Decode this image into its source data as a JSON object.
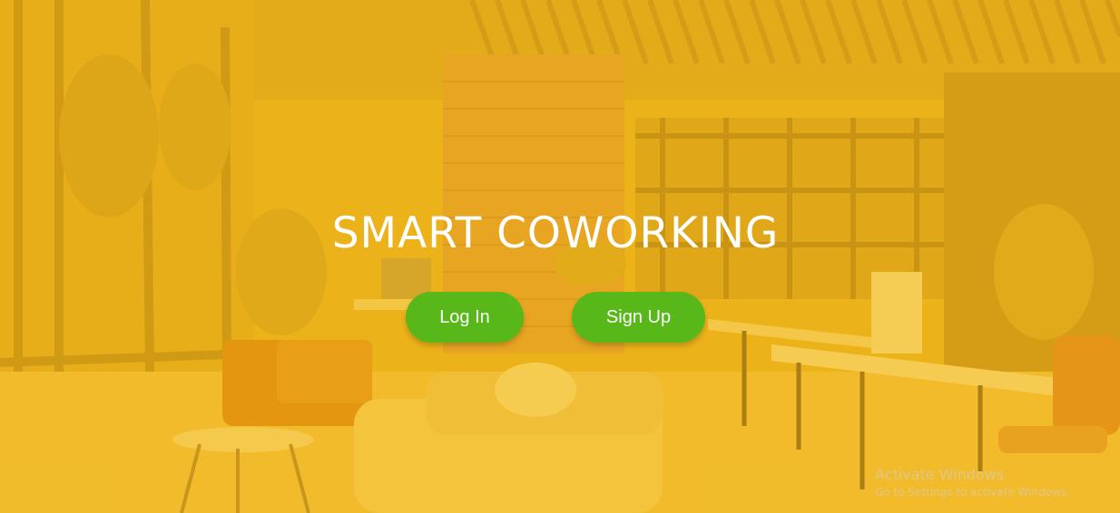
{
  "hero": {
    "title": "SMART COWORKING"
  },
  "buttons": {
    "login_label": "Log In",
    "signup_label": "Sign Up"
  },
  "watermark": {
    "title": "Activate Windows",
    "subtitle": "Go to Settings to activate Windows."
  },
  "colors": {
    "overlay": "#ecb31e",
    "button": "#58b81a",
    "text": "#ffffff"
  }
}
